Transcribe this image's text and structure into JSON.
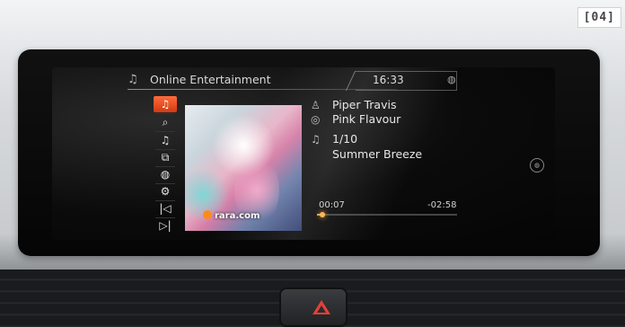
{
  "figure_label": "[04]",
  "header": {
    "icon": "online-entertainment-icon",
    "title": "Online Entertainment",
    "time": "16:33",
    "status_icon": "network-icon"
  },
  "menu": {
    "items": [
      {
        "name": "now-playing-icon",
        "glyph": "♫",
        "active": true
      },
      {
        "name": "search-icon",
        "glyph": "⌕",
        "active": false
      },
      {
        "name": "playlist-icon",
        "glyph": "♫",
        "active": false
      },
      {
        "name": "stations-icon",
        "glyph": "⧉",
        "active": false
      },
      {
        "name": "internet-icon",
        "glyph": "◍",
        "active": false
      },
      {
        "name": "settings-icon",
        "glyph": "⚙",
        "active": false
      },
      {
        "name": "previous-track-icon",
        "glyph": "⏮",
        "active": false
      },
      {
        "name": "next-track-icon",
        "glyph": "⏭",
        "active": false
      }
    ]
  },
  "cover": {
    "brand": "rara.com"
  },
  "track": {
    "artist_icon": "person-icon",
    "artist": "Piper Travis",
    "album_icon": "album-icon",
    "album": "Pink Flavour",
    "track_icon": "music-note-icon",
    "track_number": "1/10",
    "title": "Summer Breeze"
  },
  "playback": {
    "elapsed": "00:07",
    "remaining": "-02:58",
    "progress": 0.04
  },
  "colors": {
    "accent": "#e8542a",
    "progress": "#c8a060",
    "hazard": "#e2403a"
  }
}
